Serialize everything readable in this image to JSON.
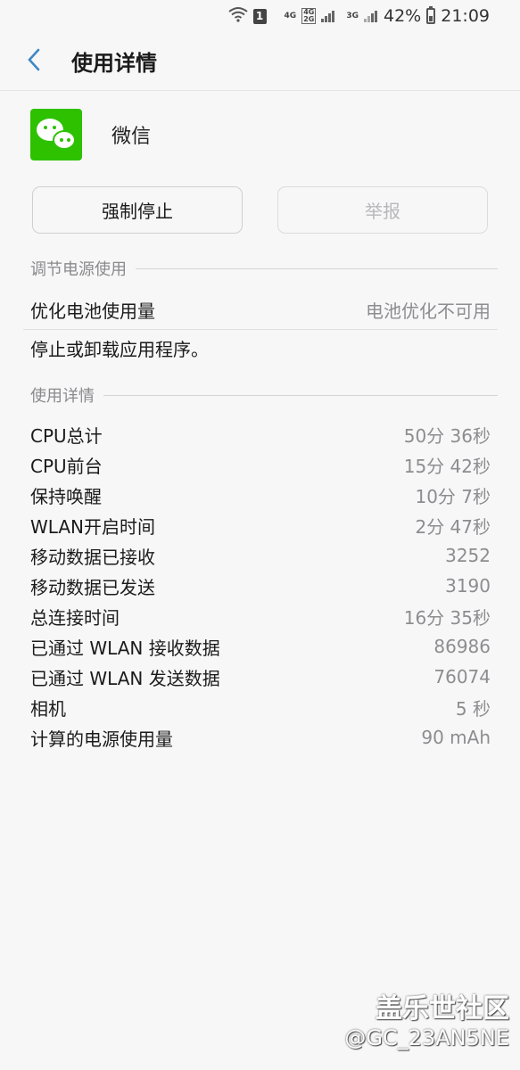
{
  "status_bar": {
    "sim_badge": "1",
    "net1": "4G",
    "net2_top": "4G",
    "net2_bottom": "2G",
    "net3": "3G",
    "battery": "42%",
    "time": "21:09"
  },
  "header": {
    "back_icon": "chevron-left-icon",
    "title": "使用详情"
  },
  "app": {
    "icon": "wechat-icon",
    "name": "微信"
  },
  "buttons": {
    "force_stop": "强制停止",
    "report": "举报"
  },
  "power_section": {
    "title": "调节电源使用",
    "optimize_label": "优化电池使用量",
    "optimize_value": "电池优化不可用",
    "note": "停止或卸载应用程序。"
  },
  "usage_section": {
    "title": "使用详情",
    "items": [
      {
        "label": "CPU总计",
        "value": "50分 36秒"
      },
      {
        "label": "CPU前台",
        "value": "15分 42秒"
      },
      {
        "label": "保持唤醒",
        "value": "10分 7秒"
      },
      {
        "label": "WLAN开启时间",
        "value": "2分 47秒"
      },
      {
        "label": "移动数据已接收",
        "value": "3252"
      },
      {
        "label": "移动数据已发送",
        "value": "3190"
      },
      {
        "label": "总连接时间",
        "value": "16分 35秒"
      },
      {
        "label": "已通过 WLAN 接收数据",
        "value": "86986"
      },
      {
        "label": "已通过 WLAN 发送数据",
        "value": "76074"
      },
      {
        "label": "相机",
        "value": "5 秒"
      },
      {
        "label": "计算的电源使用量",
        "value": "90 mAh"
      }
    ]
  },
  "watermark": {
    "line1": "盖乐世社区",
    "line2": "@GC_23AN5NE"
  }
}
